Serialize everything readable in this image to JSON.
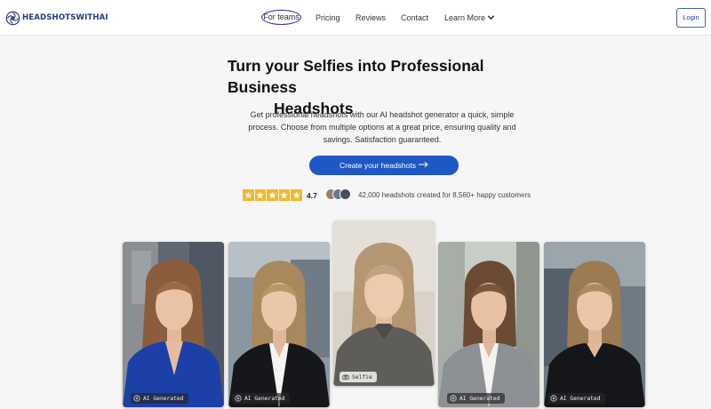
{
  "brand": {
    "name": "HEADSHOTSWITHAI",
    "logo_icon": "swirl-logo-icon",
    "color": "#263a80"
  },
  "nav": {
    "items": [
      {
        "label": "For teams",
        "highlighted": true
      },
      {
        "label": "Pricing"
      },
      {
        "label": "Reviews"
      },
      {
        "label": "Contact"
      },
      {
        "label": "Learn More",
        "icon": "chevron-down-icon"
      }
    ],
    "login_label": "Login"
  },
  "hero": {
    "title_line1": "Turn your Selfies into Professional Business",
    "title_line2": "Headshots",
    "subtitle": "Get professional headshots with our AI headshot generator a quick, simple process. Choose from multiple options at a great price, ensuring quality and savings. Satisfaction guaranteed.",
    "cta_label": "Create your headshots",
    "cta_icon": "arrow-right-icon",
    "accent_color": "#1f58c4"
  },
  "social_proof": {
    "stars": 5,
    "rating": "4.7",
    "customers_text": "42,000 headshots created for 8,560+ happy customers"
  },
  "gallery": [
    {
      "tag": "AI Generated",
      "outfit": "blue blazer"
    },
    {
      "tag": "AI Generated",
      "outfit": "black blazer, white shirt"
    },
    {
      "tag": "Selfie",
      "outfit": "grey knit sweater"
    },
    {
      "tag": "AI Generated",
      "outfit": "grey blazer, white shirt"
    },
    {
      "tag": "AI Generated",
      "outfit": "black blazer"
    }
  ]
}
